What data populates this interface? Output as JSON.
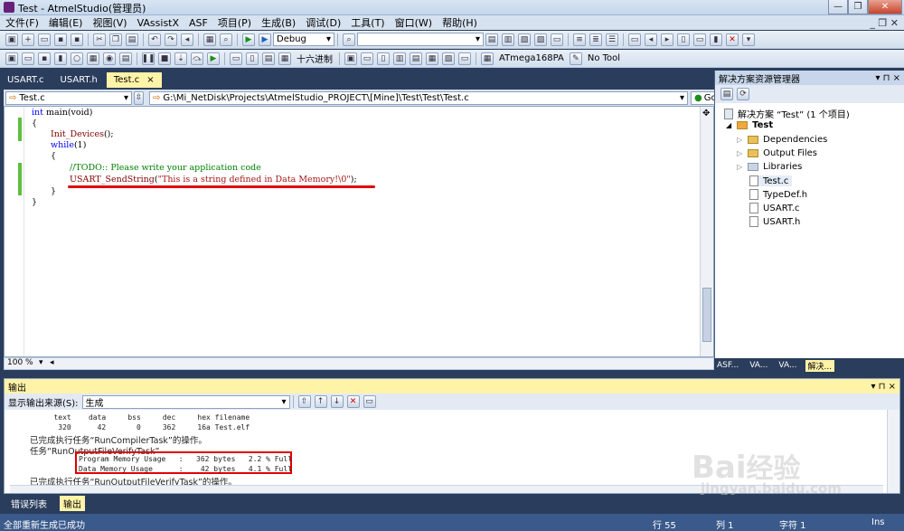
{
  "window": {
    "title": "Test - AtmelStudio(管理员)",
    "min_glyph": "—",
    "restore_glyph": "❐",
    "close_glyph": "✕"
  },
  "menu": [
    "文件(F)",
    "编辑(E)",
    "视图(V)",
    "VAssistX",
    "ASF",
    "项目(P)",
    "生成(B)",
    "调试(D)",
    "工具(T)",
    "窗口(W)",
    "帮助(H)"
  ],
  "mdi_controls": "_ ❐ ✕",
  "toolbar1": {
    "config": "Debug",
    "search_value": ""
  },
  "toolbar2": {
    "hex_label": "十六进制",
    "device": "ATmega168PA",
    "tool": "No Tool"
  },
  "doc_tabs": [
    {
      "label": "USART.c",
      "active": false
    },
    {
      "label": "USART.h",
      "active": false
    },
    {
      "label": "Test.c",
      "active": true,
      "close": "×"
    }
  ],
  "nav": {
    "file": "Test.c",
    "path": "G:\\Mi_NetDisk\\Projects\\AtmelStudio_PROJECT\\[Mine]\\Test\\Test\\Test.c",
    "go": "Go"
  },
  "code": {
    "l1_kw": "int",
    "l1_rest": " main(void)",
    "l2": "{",
    "l3_fn": "Init_Devices",
    "l3_rest": "();",
    "l4_kw": "while",
    "l4_rest": "(1)",
    "l5": "{",
    "l6_comment": "//TODO:: Please write your application code",
    "l7_fn": "USART_SendString",
    "l7_str": "\"This is a string defined in Data Memory!\\0\"",
    "l7_open": "(",
    "l7_close": ");",
    "l8": "}",
    "l9": "}"
  },
  "zoom": "100 %",
  "solution": {
    "title": "解决方案资源管理器",
    "pin": "▾ ⊓ ×",
    "root": "解决方案 “Test” (1 个项目)",
    "project": "Test",
    "items": [
      "Dependencies",
      "Output Files",
      "Libraries",
      "Test.c",
      "TypeDef.h",
      "USART.c",
      "USART.h"
    ],
    "bottom_tabs": [
      "ASF...",
      "VA...",
      "VA...",
      "解决..."
    ]
  },
  "output": {
    "title": "输出",
    "source_label": "显示输出来源(S):",
    "source_value": "生成",
    "lines": {
      "header": "   text    data     bss     dec     hex filename",
      "values": "    320      42       0     362     16a Test.elf",
      "done_compiler": "已完成执行任务“RunCompilerTask”的操作。",
      "task_verify": "任务“RunOutputFileVerifyTask”",
      "program_mem": "Program Memory Usage   :   362 bytes   2.2 % Full",
      "data_mem": "Data Memory Usage      :    42 bytes   4.1 % Full",
      "done_verify": "已完成执行任务“RunOutputFileVerifyTask”的操作。"
    }
  },
  "output_tabs": [
    "错误列表",
    "输出"
  ],
  "status": {
    "message": "全部重新生成已成功",
    "row": "行 55",
    "col": "列 1",
    "char": "字符 1",
    "mode": "Ins"
  },
  "watermark": {
    "brand": "Bai",
    "brand2": "经验",
    "url": "jingyan.baidu.com"
  },
  "colors": {
    "accent": "#2b3d5c",
    "active_tab": "#fff3a8",
    "highlight": "#e00000"
  }
}
